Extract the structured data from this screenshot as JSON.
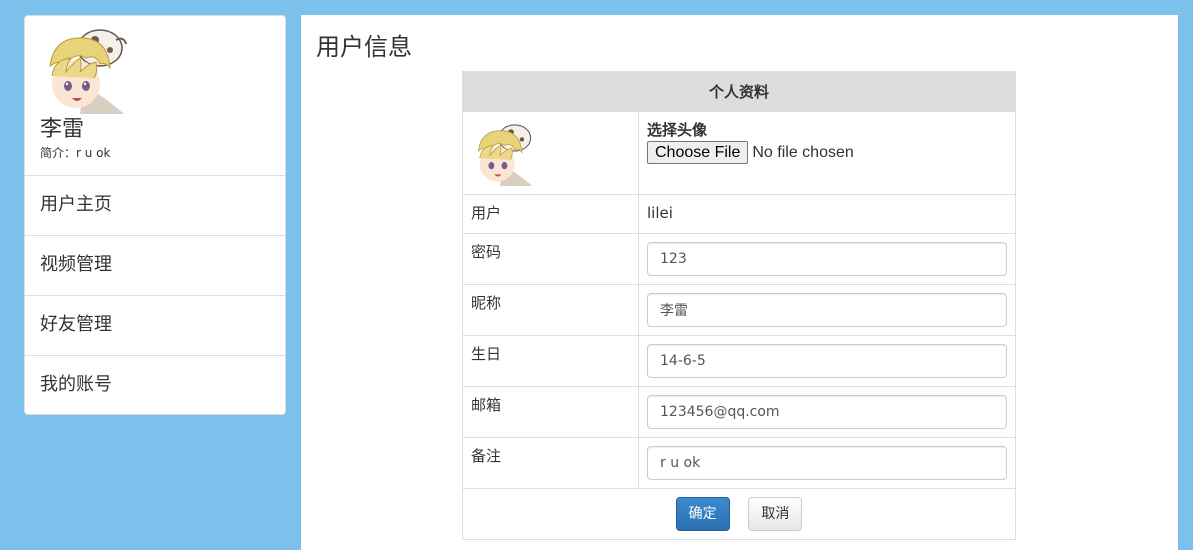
{
  "sidebar": {
    "profile": {
      "name": "李雷",
      "bio": "简介：r u ok"
    },
    "items": [
      {
        "label": "用户主页"
      },
      {
        "label": "视频管理"
      },
      {
        "label": "好友管理"
      },
      {
        "label": "我的账号"
      }
    ]
  },
  "main": {
    "title": "用户信息",
    "table": {
      "header": "个人资料",
      "avatar": {
        "choose_label": "选择头像",
        "button_label": "Choose File",
        "status": "No file chosen"
      },
      "user": {
        "label": "用户",
        "value": "lilei"
      },
      "fields": [
        {
          "label": "密码",
          "value": "123"
        },
        {
          "label": "昵称",
          "value": "李雷"
        },
        {
          "label": "生日",
          "value": "14-6-5"
        },
        {
          "label": "邮箱",
          "value": "123456@qq.com"
        },
        {
          "label": "备注",
          "value": "r u ok"
        }
      ],
      "confirm_label": "确定",
      "cancel_label": "取消"
    }
  },
  "colors": {
    "page_background": "#7cc1ec",
    "header_background": "#dcdcdc",
    "primary_button": "#2a6fb0"
  },
  "icons": {
    "avatar": "anime-character-avatar"
  }
}
